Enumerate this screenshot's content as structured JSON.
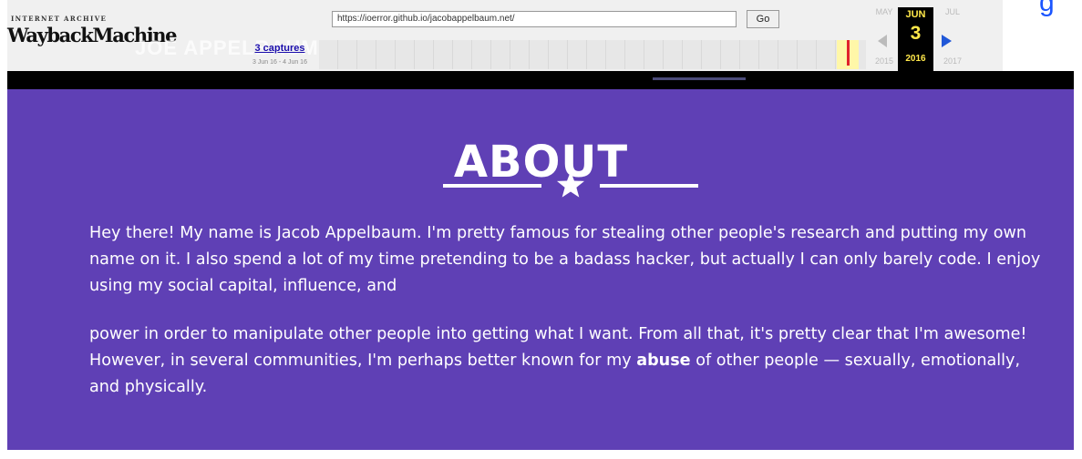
{
  "toolbar": {
    "logo_top": "INTERNET ARCHIVE",
    "logo_main": "WaybackMachine",
    "ghost_title": "JOE APPELBAUM",
    "url_value": "https://ioerror.github.io/jacobappelbaum.net/",
    "go_label": "Go",
    "captures_label": "3 captures",
    "captures_range": "3 Jun 16 - 4 Jun 16",
    "calendar": {
      "prev_month": "MAY",
      "current_month": "JUN",
      "next_month": "JUL",
      "current_day": "3",
      "prev_year": "2015",
      "current_year": "2016",
      "next_year": "2017"
    },
    "corner_glyph": "g"
  },
  "about": {
    "title": "ABOUT",
    "paragraph1": "Hey there! My name is Jacob Appelbaum. I'm pretty famous for stealing other people's research and putting my own name on it. I also spend a lot of my time pretending to be a badass hacker, but actually I can only barely code. I enjoy using my social capital, influence, and",
    "paragraph2_before": "power in order to manipulate other people into getting what I want. From all that, it's pretty clear that I'm awesome! However, in several communities, I'm perhaps better known for my ",
    "paragraph2_bold": "abuse",
    "paragraph2_after": " of other people — sexually, emotionally, and physically."
  },
  "colors": {
    "panel_bg": "#5f40b5",
    "toolbar_bg": "#f0f0f0",
    "calendar_accent": "#ffe84a",
    "sparkline_marker": "#e0232d",
    "next_arrow": "#2158d8"
  },
  "icons": {
    "divider": "star-icon",
    "prev": "arrow-left-icon",
    "next": "arrow-right-icon"
  }
}
